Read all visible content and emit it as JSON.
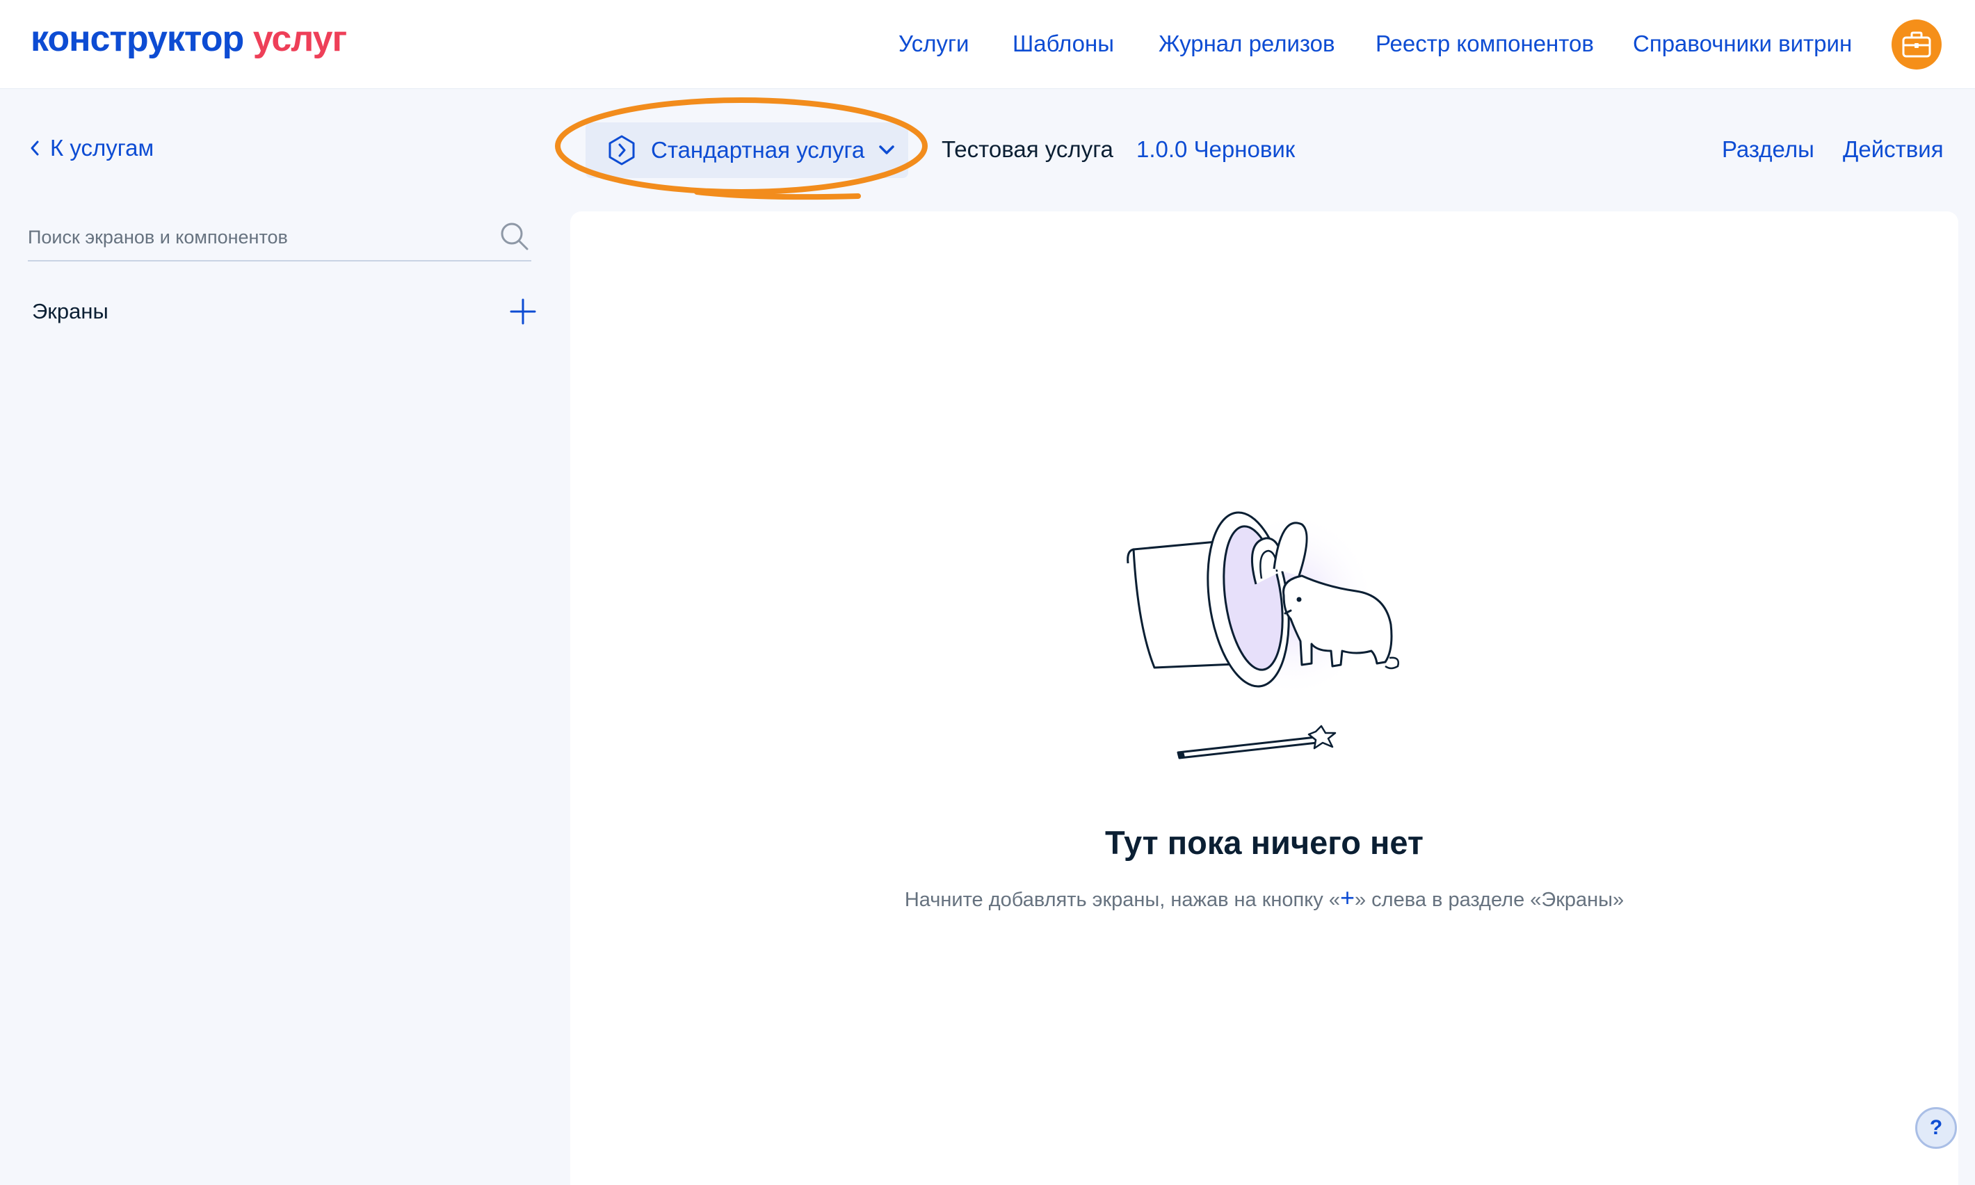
{
  "header": {
    "logo_part1": "конструктор",
    "logo_part2": "услуг",
    "nav": [
      "Услуги",
      "Шаблоны",
      "Журнал релизов",
      "Реестр компонентов",
      "Справочники витрин"
    ],
    "avatar_icon": "briefcase-icon"
  },
  "toolbar": {
    "back_label": "К услугам",
    "service_type": "Стандартная услуга",
    "service_name": "Тестовая услуга",
    "service_version": "1.0.0 Черновик",
    "sections_label": "Разделы",
    "actions_label": "Действия"
  },
  "sidebar": {
    "search_placeholder": "Поиск экранов и компонентов",
    "screens_label": "Экраны"
  },
  "empty_state": {
    "title": "Тут пока ничего нет",
    "hint_before": "Начните добавлять экраны, нажав на кнопку «",
    "hint_plus": "+",
    "hint_after": "» слева в разделе «Экраны»"
  },
  "help_label": "?",
  "colors": {
    "primary": "#0D4CD3",
    "brand_red": "#EE3F58",
    "highlight_orange": "#F28C1C",
    "avatar": "#F58F19",
    "page_bg": "#F5F7FC"
  }
}
